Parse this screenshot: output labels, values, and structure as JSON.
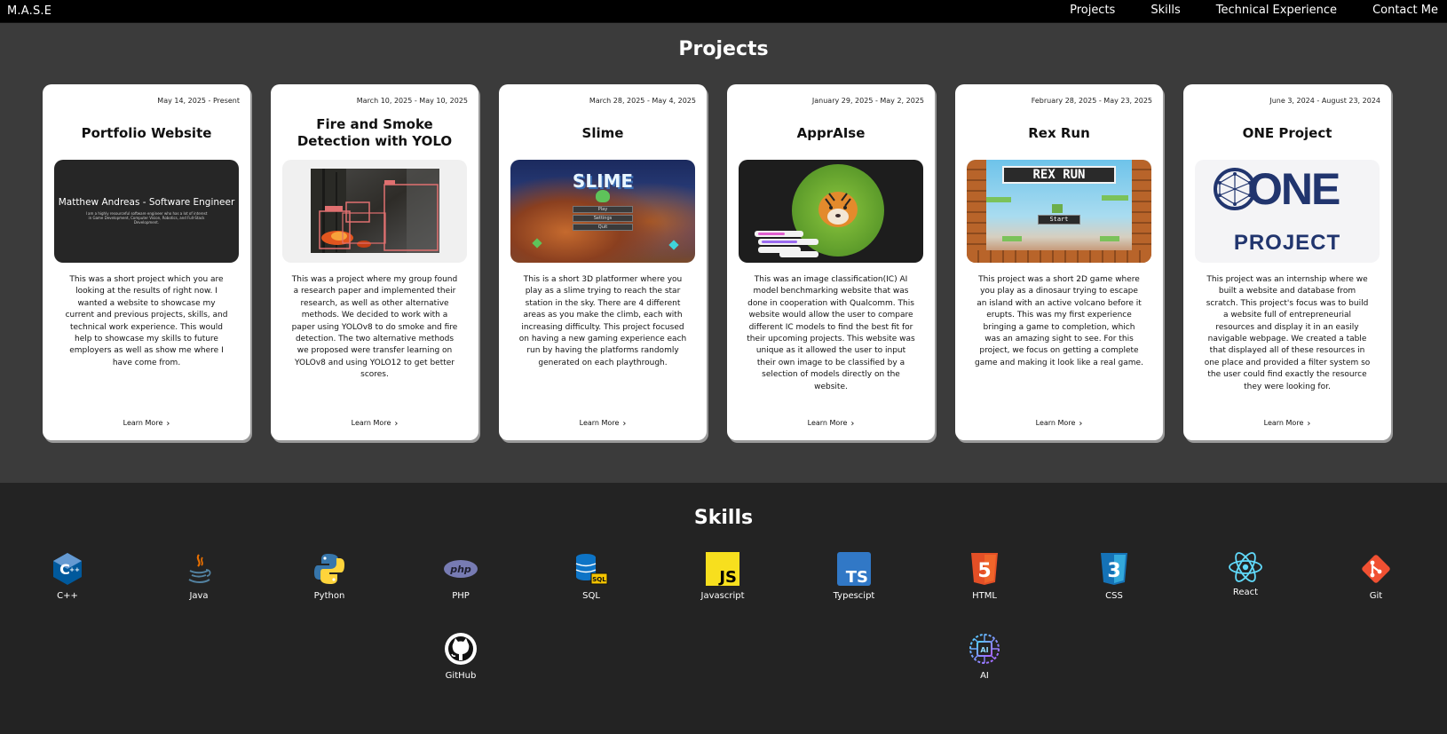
{
  "nav": {
    "brand": "M.A.S.E",
    "links": [
      "Projects",
      "Skills",
      "Technical Experience",
      "Contact Me"
    ]
  },
  "projects": {
    "title": "Projects",
    "learn_more_label": "Learn More",
    "cards": [
      {
        "date": "May 14, 2025 - Present",
        "title": "Portfolio Website",
        "image_heading": "Matthew Andreas - Software Engineer",
        "image_sub": "I am a highly resourceful software engineer who has a lot of interest in Game Development, Computer Vision, Robotics, and Full-Stack Development.",
        "description": "This was a short project which you are looking at the results of right now. I wanted a website to showcase my current and previous projects, skills, and technical work experience. This would help to showcase my skills to future employers as well as show me where I have come from."
      },
      {
        "date": "March 10, 2025 - May 10, 2025",
        "title": "Fire and Smoke Detection with YOLO",
        "description": "This was a project where my group found a research paper and implemented their research, as well as other alternative methods. We decided to work with a paper using YOLOv8 to do smoke and fire detection. The two alternative methods we proposed were transfer learning on YOLOv8 and using YOLO12 to get better scores."
      },
      {
        "date": "March 28, 2025 - May 4, 2025",
        "title": "Slime",
        "image_heading": "SLIME",
        "image_buttons": [
          "Play",
          "Settings",
          "Quit"
        ],
        "description": "This is a short 3D platformer where you play as a slime trying to reach the star station in the sky. There are 4 different areas as you make the climb, each with increasing difficulty. This project focused on having a new gaming experience each run by having the platforms randomly generated on each playthrough."
      },
      {
        "date": "January 29, 2025 - May 2, 2025",
        "title": "ApprAIse",
        "description": "This was an image classification(IC) AI model benchmarking website that was done in cooperation with Qualcomm. This website would allow the user to compare different IC models to find the best fit for their upcoming projects. This website was unique as it allowed the user to input their own image to be classified by a selection of models directly on the website."
      },
      {
        "date": "February 28, 2025 - May 23, 2025",
        "title": "Rex Run",
        "image_heading": "REX RUN",
        "image_button": "Start",
        "description": "This project was a short 2D game where you play as a dinosaur trying to escape an island with an active volcano before it erupts. This was my first experience bringing a game to completion, which was an amazing sight to see. For this project, we focus on getting a complete game and making it look like a real game."
      },
      {
        "date": "June 3, 2024 - August 23, 2024",
        "title": "ONE Project",
        "image_heading": "ONE",
        "image_sub": "PROJECT",
        "description": "This project was an internship where we built a website and database from scratch. This project's focus was to build a website full of entrepreneurial resources and display it in an easily navigable webpage. We created a table that displayed all of these resources in one place and provided a filter system so the user could find exactly the resource they were looking for."
      }
    ]
  },
  "skills": {
    "title": "Skills",
    "items": [
      {
        "label": "C++",
        "icon": "cplusplus-icon"
      },
      {
        "label": "Java",
        "icon": "java-icon"
      },
      {
        "label": "Python",
        "icon": "python-icon"
      },
      {
        "label": "PHP",
        "icon": "php-icon",
        "glyph": "php"
      },
      {
        "label": "SQL",
        "icon": "sql-icon",
        "glyph": "SQL"
      },
      {
        "label": "Javascript",
        "icon": "javascript-icon",
        "glyph": "JS"
      },
      {
        "label": "Typescipt",
        "icon": "typescript-icon",
        "glyph": "TS"
      },
      {
        "label": "HTML",
        "icon": "html5-icon",
        "glyph": "5"
      },
      {
        "label": "CSS",
        "icon": "css3-icon",
        "glyph": "3"
      },
      {
        "label": "React",
        "icon": "react-icon"
      },
      {
        "label": "Git",
        "icon": "git-icon"
      },
      {
        "label": "GitHub",
        "icon": "github-icon"
      },
      {
        "label": "AI",
        "icon": "ai-chip-icon",
        "glyph": "AI"
      }
    ]
  },
  "colors": {
    "nav_bg": "#000000",
    "projects_bg": "#3b3b3b",
    "skills_bg": "#232323",
    "card_bg": "#ffffff"
  }
}
